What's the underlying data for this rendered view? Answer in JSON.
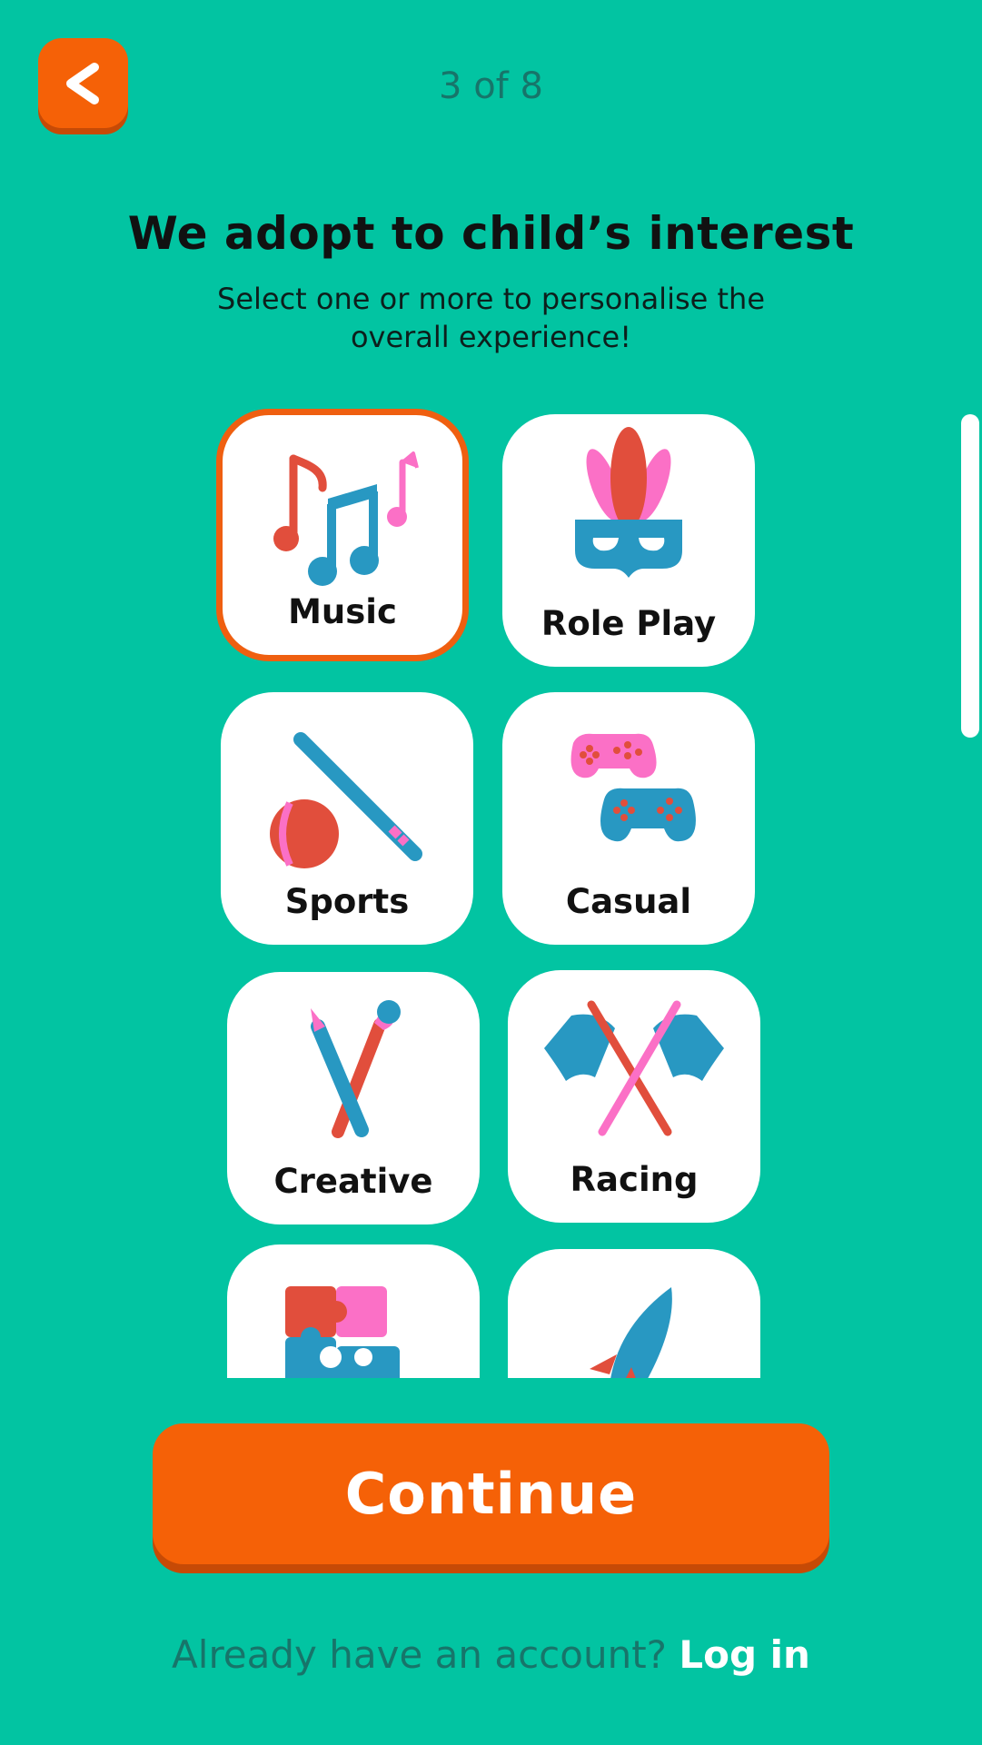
{
  "header": {
    "step_text": "3 of 8",
    "back_icon": "chevron-left-icon"
  },
  "main": {
    "title": "We adopt to child’s interest",
    "subtitle": "Select one or more to personalise the overall experience!"
  },
  "interests": [
    {
      "label": "Music",
      "icon": "music-notes-icon",
      "selected": true
    },
    {
      "label": "Role Play",
      "icon": "mask-icon",
      "selected": false
    },
    {
      "label": "Sports",
      "icon": "bat-and-ball-icon",
      "selected": false
    },
    {
      "label": "Casual",
      "icon": "gamepad-icon",
      "selected": false
    },
    {
      "label": "Creative",
      "icon": "pencil-brush-icon",
      "selected": false
    },
    {
      "label": "Racing",
      "icon": "crossed-flags-icon",
      "selected": false
    },
    {
      "label": "",
      "icon": "puzzle-icon",
      "selected": false
    },
    {
      "label": "",
      "icon": "rocket-icon",
      "selected": false
    }
  ],
  "footer": {
    "continue_label": "Continue",
    "login_prompt": "Already have an account?",
    "login_link": "Log in"
  },
  "colors": {
    "background": "#02c4a2",
    "accent": "#f56107",
    "card": "#ffffff",
    "icon_blue": "#2898c2",
    "icon_red": "#e14e3c",
    "icon_pink": "#fb70c6"
  }
}
